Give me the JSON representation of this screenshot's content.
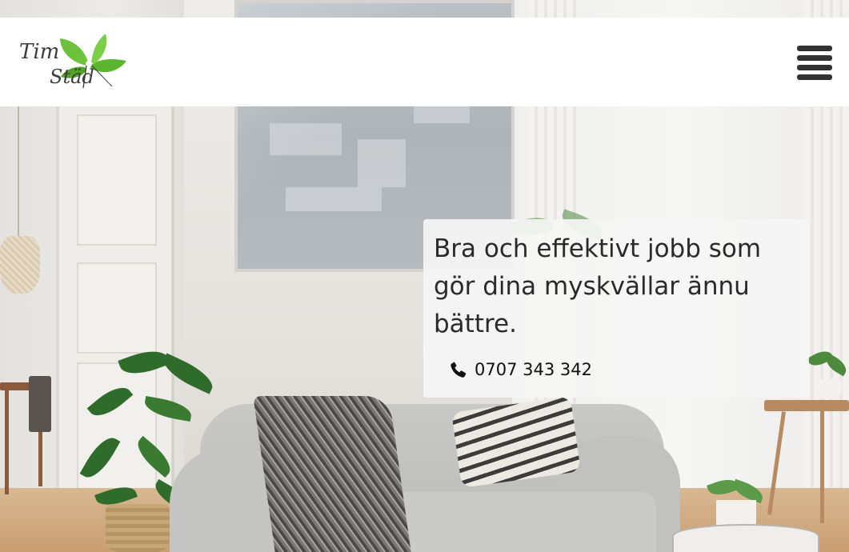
{
  "header": {
    "logo": {
      "text_line1": "Tim",
      "text_line2": "Städ",
      "leaf_color": "#5cb531",
      "icon": "leaf-logo-icon"
    },
    "menu_icon": "hamburger-menu-icon"
  },
  "hero": {
    "title": "Bra och effektivt jobb som gör dina myskvällar ännu bättre.",
    "phone_icon": "phone-icon",
    "phone_number": "0707 343 342"
  },
  "colors": {
    "header_bg": "#ffffff",
    "card_bg": "#f5f5f5",
    "text": "#2a2a2a",
    "menu_icon": "#333333"
  }
}
